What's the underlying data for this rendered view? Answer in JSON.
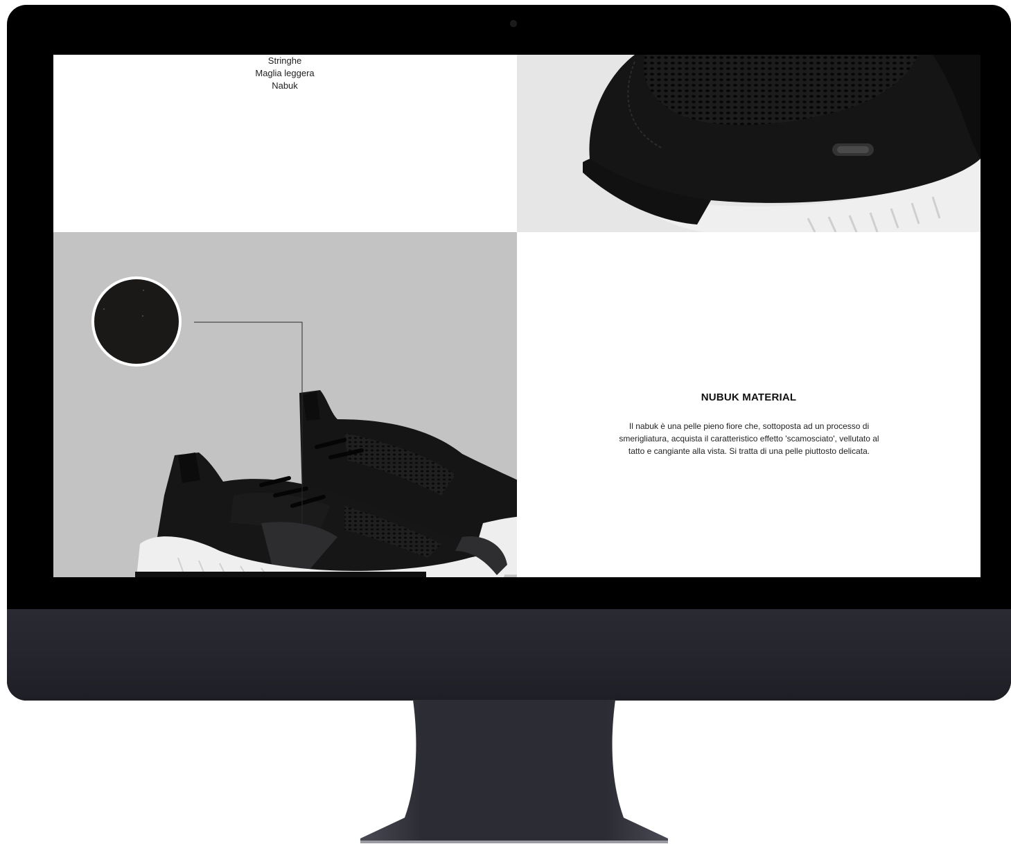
{
  "features": {
    "items": [
      "Stringhe",
      "Maglia leggera",
      "Nabuk"
    ]
  },
  "material": {
    "title": "NUBUK MATERIAL",
    "description": "Il nabuk è una pelle pieno fiore che, sottoposta ad un processo di smerigliatura, acquista il caratteristico effetto 'scamosciato', vellutato al tatto e cangiante alla vista. Si tratta di una pelle piuttosto delicata."
  },
  "colors": {
    "bezel": "#000000",
    "chin": "#26262e",
    "panel_gray": "#c3c3c4",
    "panel_light": "#e6e6e7",
    "shoe": "#141414",
    "sole": "#efefef"
  }
}
